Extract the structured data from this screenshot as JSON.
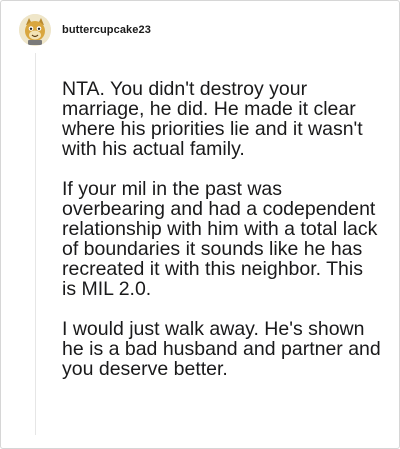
{
  "post": {
    "username": "buttercupcake23",
    "avatar_icon": "cartoon-avatar-icon",
    "paragraphs": [
      "NTA. You didn't destroy your marriage, he did. He made it clear where his priorities lie and it wasn't with his actual family.",
      "If your mil in the past was overbearing and had a codependent relationship with him with a total lack of boundaries it sounds like he has recreated it with this neighbor. This is MIL 2.0.",
      "I would just walk away. He's shown he is a bad husband and partner and you deserve better."
    ]
  },
  "colors": {
    "text": "#1a1a1b",
    "border": "#d6d6d6",
    "thread_line": "#e6e6e6",
    "avatar_bg": "#e8e0c8"
  }
}
